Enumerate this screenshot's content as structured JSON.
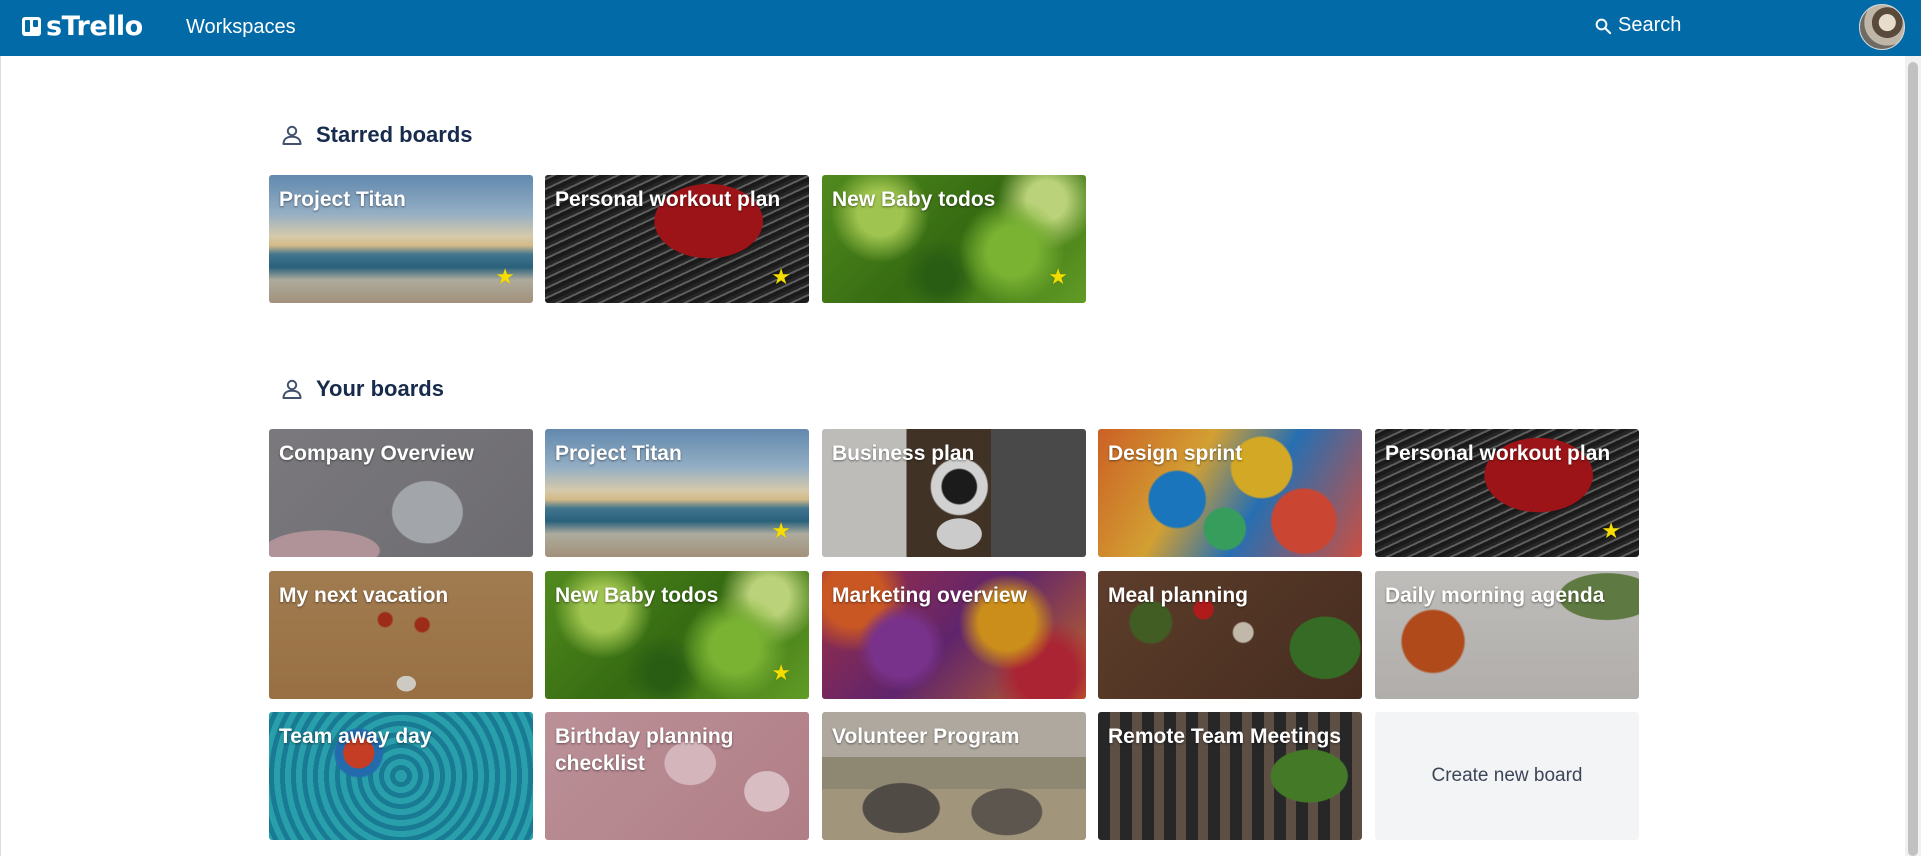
{
  "app": {
    "logo_text": "sTrello",
    "nav": {
      "workspaces_label": "Workspaces"
    },
    "search_label": "Search"
  },
  "starred": {
    "heading": "Starred boards",
    "boards": [
      {
        "title": "Project Titan",
        "starred": true
      },
      {
        "title": "Personal workout plan",
        "starred": true
      },
      {
        "title": "New Baby todos",
        "starred": true
      }
    ]
  },
  "your_boards": {
    "heading": "Your boards",
    "boards": [
      {
        "title": "Company Overview",
        "starred": false
      },
      {
        "title": "Project Titan",
        "starred": true
      },
      {
        "title": "Business plan",
        "starred": false
      },
      {
        "title": "Design sprint",
        "starred": false
      },
      {
        "title": "Personal workout plan",
        "starred": true
      },
      {
        "title": "My next vacation",
        "starred": false
      },
      {
        "title": "New Baby todos",
        "starred": true
      },
      {
        "title": "Marketing overview",
        "starred": false
      },
      {
        "title": "Meal planning",
        "starred": false
      },
      {
        "title": "Daily morning agenda",
        "starred": false
      },
      {
        "title": "Team away day",
        "starred": false
      },
      {
        "title": "Birthday planning checklist",
        "starred": false
      },
      {
        "title": "Volunteer Program",
        "starred": false
      },
      {
        "title": "Remote Team Meetings",
        "starred": false
      }
    ],
    "create_label": "Create new board"
  },
  "icons": {
    "star": "★",
    "section_icon": "person-icon",
    "search_icon": "search-icon"
  },
  "colors": {
    "header_bg": "#026aa7",
    "star": "#f5dd00",
    "heading_text": "#172b4d"
  }
}
